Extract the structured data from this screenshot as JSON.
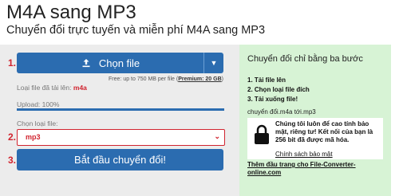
{
  "header": {
    "title": "M4A sang MP3",
    "subtitle": "Chuyển đổi trực tuyến và miễn phí M4A sang MP3"
  },
  "left": {
    "step1": "1.",
    "step2": "2.",
    "step3": "3.",
    "choose_label": "Chọn file",
    "free_note_prefix": "Free: up to 750 MB per file (",
    "free_note_link": "Premium: 20 GB",
    "free_note_suffix": ")",
    "uploaded_label": "Loại file đã tải lên: ",
    "uploaded_value": "m4a",
    "upload_progress": "Upload: 100%",
    "progress_fraction": 1.0,
    "select_label": "Chọn loại file:",
    "select_value": "mp3",
    "start_label": "Bắt đầu chuyển đổi!"
  },
  "right": {
    "title": "Chuyển đổi chỉ bằng ba bước",
    "steps": [
      "1. Tải file lên",
      "2. Chọn loại file đích",
      "3. Tải xuống file!"
    ],
    "conversion": "chuyển đổi.m4a tới.mp3",
    "security_text": "Chúng tôi luôn để cao tính bảo mật, riêng tư! Kết nối của bạn là 256 bit đã được mã hóa.",
    "security_link": "Chính sách bảo mật",
    "add_link": "Thêm đầu trang cho File-Converter-online.com"
  },
  "colors": {
    "accent": "#2b6cb0",
    "step": "#d1242f",
    "right_panel": "#d7f3d5"
  }
}
